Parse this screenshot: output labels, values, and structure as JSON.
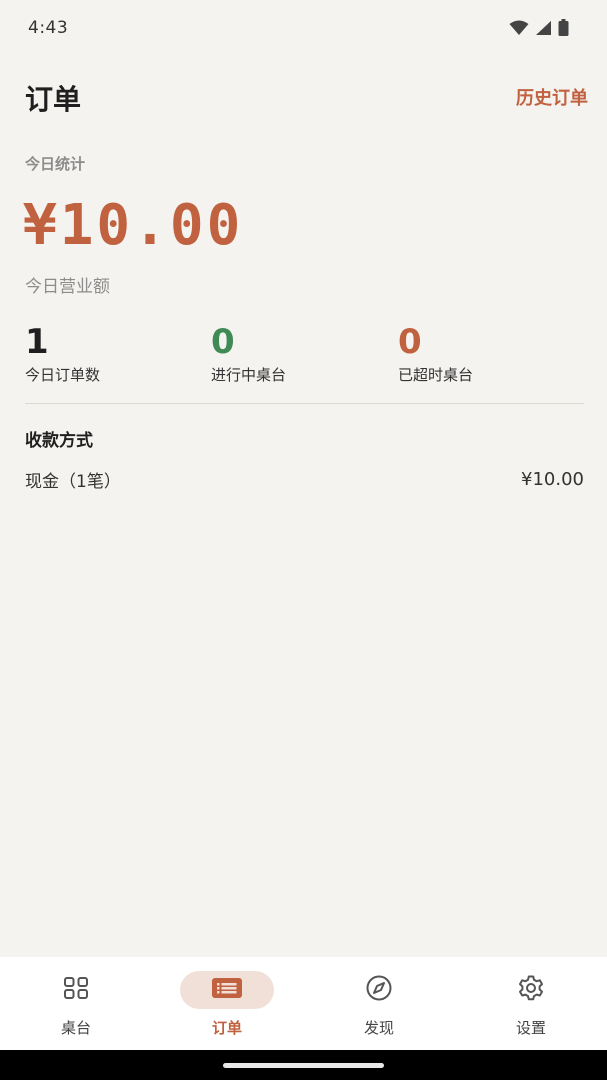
{
  "status_bar": {
    "time": "4:43",
    "icons": [
      "wifi-icon",
      "signal-icon",
      "battery-icon"
    ]
  },
  "header": {
    "title": "订单",
    "history_link": "历史订单"
  },
  "today": {
    "section_label": "今日统计",
    "revenue_amount": "¥10.00",
    "revenue_label": "今日营业额",
    "stats": [
      {
        "value": "1",
        "label": "今日订单数",
        "color": "#1f1f1f"
      },
      {
        "value": "0",
        "label": "进行中桌台",
        "color": "#3f8a55"
      },
      {
        "value": "0",
        "label": "已超时桌台",
        "color": "#c0613f"
      }
    ]
  },
  "payment": {
    "title": "收款方式",
    "rows": [
      {
        "name": "现金（1笔）",
        "amount": "¥10.00"
      }
    ]
  },
  "bottom_nav": {
    "items": [
      {
        "label": "桌台",
        "icon": "grid-icon",
        "active": false
      },
      {
        "label": "订单",
        "icon": "order-list-icon",
        "active": true
      },
      {
        "label": "发现",
        "icon": "compass-icon",
        "active": false
      },
      {
        "label": "设置",
        "icon": "gear-icon",
        "active": false
      }
    ]
  },
  "colors": {
    "accent": "#c0613f",
    "green": "#3f8a55",
    "background": "#f5f3ef",
    "active_pill": "#f0e0d8"
  }
}
